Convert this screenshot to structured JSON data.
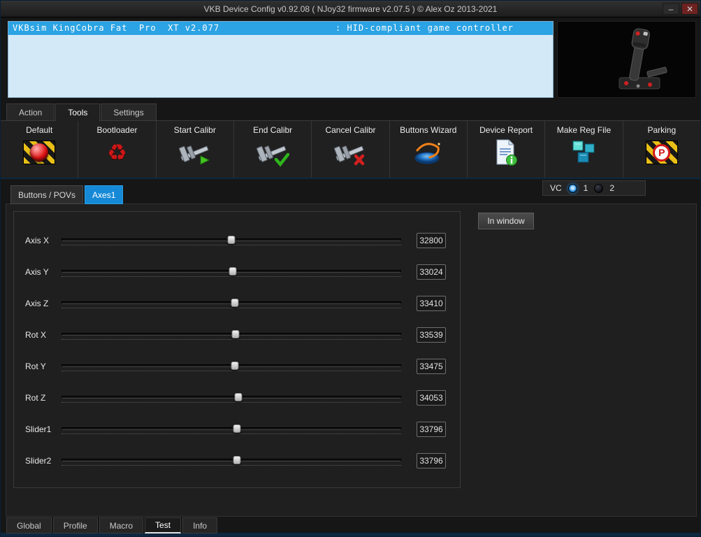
{
  "window": {
    "title": "VKB Device Config v0.92.08 ( NJoy32 firmware v2.07.5 ) © Alex Oz 2013-2021",
    "controls": {
      "minimize": "–",
      "close": "✕"
    }
  },
  "device_list": {
    "selected_name": "VKBsim KingCobra Fat  Pro  XT v2.077",
    "selected_type": ": HID-compliant game controller"
  },
  "main_tabs": {
    "items": [
      {
        "label": "Action",
        "active": false
      },
      {
        "label": "Tools",
        "active": true
      },
      {
        "label": "Settings",
        "active": false
      }
    ]
  },
  "toolbar": {
    "items": [
      {
        "label": "Default",
        "icon": "hazard-ball-icon"
      },
      {
        "label": "Bootloader",
        "icon": "recycle-icon",
        "glyph": "♻"
      },
      {
        "label": "Start Calibr",
        "icon": "caliper-play-icon"
      },
      {
        "label": "End Calibr",
        "icon": "caliper-check-icon"
      },
      {
        "label": "Cancel Calibr",
        "icon": "caliper-cross-icon"
      },
      {
        "label": "Buttons Wizard",
        "icon": "ufo-swirl-icon"
      },
      {
        "label": "Device Report",
        "icon": "document-info-icon"
      },
      {
        "label": "Make Reg File",
        "icon": "registry-blocks-icon"
      },
      {
        "label": "Parking",
        "icon": "parking-sign-icon",
        "glyph": "P"
      }
    ]
  },
  "subtabs": {
    "items": [
      {
        "label": "Buttons / POVs",
        "active": false
      },
      {
        "label": "Axes1",
        "active": true
      }
    ]
  },
  "vc": {
    "label": "VC",
    "options": [
      {
        "label": "1",
        "selected": true
      },
      {
        "label": "2",
        "selected": false
      }
    ]
  },
  "axes_panel": {
    "in_window_label": "In window",
    "axes": [
      {
        "label": "Axis X",
        "value": 32800,
        "max": 65535
      },
      {
        "label": "Axis Y",
        "value": 33024,
        "max": 65535
      },
      {
        "label": "Axis Z",
        "value": 33410,
        "max": 65535
      },
      {
        "label": "Rot X",
        "value": 33539,
        "max": 65535
      },
      {
        "label": "Rot Y",
        "value": 33475,
        "max": 65535
      },
      {
        "label": "Rot Z",
        "value": 34053,
        "max": 65535
      },
      {
        "label": "Slider1",
        "value": 33796,
        "max": 65535
      },
      {
        "label": "Slider2",
        "value": 33796,
        "max": 65535
      }
    ]
  },
  "bottom_tabs": {
    "items": [
      {
        "label": "Global",
        "active": false
      },
      {
        "label": "Profile",
        "active": false
      },
      {
        "label": "Macro",
        "active": false
      },
      {
        "label": "Test",
        "active": true
      },
      {
        "label": "Info",
        "active": false
      }
    ]
  },
  "colors": {
    "accent_blue": "#1689d6",
    "selection_blue": "#2ba3e4",
    "hazard_yellow": "#e9bf17",
    "alert_red": "#d42020"
  }
}
